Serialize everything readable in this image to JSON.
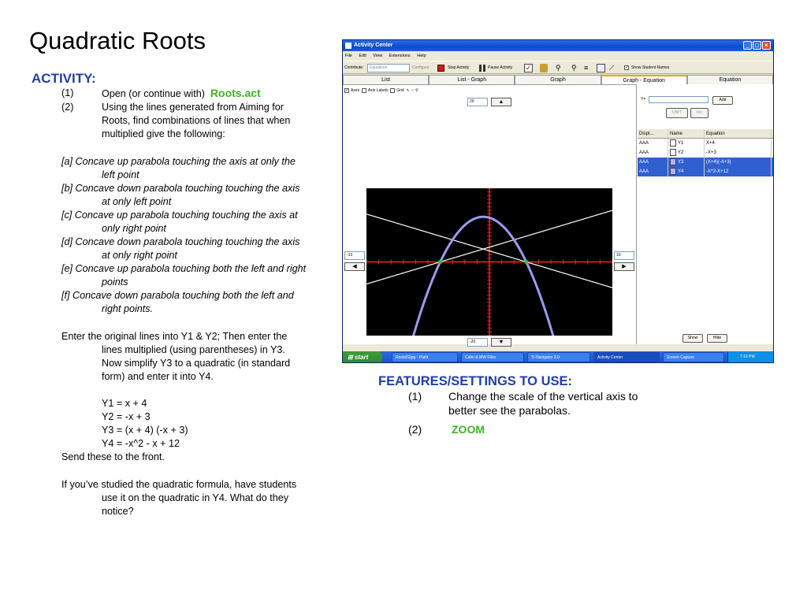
{
  "slide": {
    "title": "Quadratic Roots",
    "activity_heading": "ACTIVITY:",
    "steps": [
      {
        "num": "(1)",
        "text": "Open (or continue with)",
        "highlight": "Roots.act"
      },
      {
        "num": "(2)",
        "lines": [
          "Using the lines generated from Aiming for",
          "Roots, find combinations of lines that when",
          "multiplied give the following:"
        ]
      }
    ],
    "cases": [
      {
        "first": "[a] Concave up parabola touching the axis at only the",
        "second": "left point"
      },
      {
        "first": "[b] Concave down parabola touching touching the axis",
        "second": "at only left point"
      },
      {
        "first": "[c] Concave up parabola touching touching the axis at",
        "second": "only right point"
      },
      {
        "first": "[d] Concave down parabola touching touching the axis",
        "second": "at only right point"
      },
      {
        "first": "[e] Concave up parabola touching both the left and right",
        "second": "points"
      },
      {
        "first": "[f] Concave down parabola touching  both the left and",
        "second": "right points."
      }
    ],
    "instruction": {
      "first": "Enter the original lines into Y1 & Y2; Then enter the",
      "rest": [
        "lines multiplied (using parentheses) in Y3.",
        "Now simplify Y3 to a quadratic (in standard",
        "form) and enter it into Y4."
      ]
    },
    "equations": [
      "Y1 = x + 4",
      "Y2 = -x + 3",
      "Y3 = (x + 4) (-x + 3)",
      "Y4 = -x^2 - x + 12"
    ],
    "send": "Send these to the front.",
    "formula_note": {
      "first": "If you’ve studied the quadratic formula, have students",
      "rest": [
        "use it on the quadratic in Y4.  What do they",
        "notice?"
      ]
    },
    "features_heading": "FEATURES/SETTINGS TO USE:",
    "features": [
      {
        "num": "(1)",
        "lines": [
          "Change the scale of the vertical axis to",
          "better see the parabolas."
        ]
      },
      {
        "num": "(2)",
        "highlight": "ZOOM"
      }
    ],
    "colors": {
      "heading": "#1f3ea8",
      "highlight": "#3cb521"
    }
  },
  "app": {
    "window_title": "Activity Center",
    "menu": [
      "File",
      "Edit",
      "View",
      "Extensions",
      "Help"
    ],
    "toolbar": {
      "contribute_label": "Contribute:",
      "contribute_value": "Equations",
      "configure": "Configure",
      "stop": "Stop Activity",
      "pause": "Pause Activity",
      "show_names": "Show Student Names"
    },
    "tabs": [
      "List",
      "List - Graph",
      "Graph",
      "Graph - Equation",
      "Equation"
    ],
    "selected_tab": "Graph - Equation",
    "graph_options": [
      "Axes",
      "Axis Labels",
      "Grid"
    ],
    "ymax": "20",
    "ymin": "-20",
    "xmin": "-10",
    "xmax": "10",
    "y_input_label": "Y=",
    "add_button": "Add",
    "unit_button": "UNIT",
    "table_headers": [
      "Displ...",
      "Name",
      "Equation"
    ],
    "table_rows": [
      {
        "disp": "AAA",
        "name": "Y1",
        "eq": "X+4",
        "selected": false
      },
      {
        "disp": "AAA",
        "name": "Y2",
        "eq": "-X+3",
        "selected": false
      },
      {
        "disp": "AAA",
        "name": "Y3",
        "eq": "(X+4)(-X+3)",
        "selected": true
      },
      {
        "disp": "AAA",
        "name": "Y4",
        "eq": "-X^2-X+12",
        "selected": true
      }
    ],
    "show_button": "Show",
    "hide_button": "Hide",
    "taskbar": {
      "start": "start",
      "items": [
        "Roots02jpg - Paint",
        "Cabri & MW Files",
        "TI-Navigator 3.0",
        "Activity Center",
        "Screen Capture"
      ],
      "clock": "7:16 PM"
    }
  },
  "chart_data": {
    "type": "line",
    "xlim": [
      -10,
      10
    ],
    "ylim": [
      -20,
      20
    ],
    "series": [
      {
        "expr": "x+4",
        "color": "#ffffff"
      },
      {
        "expr": "-x+3",
        "color": "#ffffff"
      },
      {
        "expr": "-x^2-x+12",
        "color": "#9b9bf0"
      }
    ],
    "points": [
      {
        "x": -4,
        "y": 0
      },
      {
        "x": 3,
        "y": 0
      }
    ],
    "point_color": "#20d020",
    "axis_color": "#ff2020"
  }
}
